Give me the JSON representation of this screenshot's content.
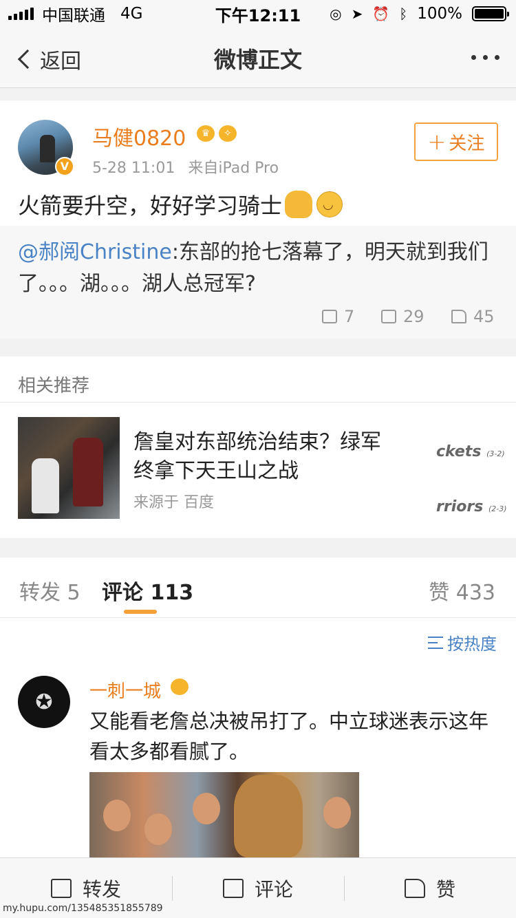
{
  "status_bar": {
    "carrier": "中国联通",
    "network": "4G",
    "time": "下午12:11",
    "battery": "100%",
    "battery_level": 1.0
  },
  "nav": {
    "back_label": "返回",
    "title": "微博正文"
  },
  "post": {
    "author": "马健0820",
    "time": "5-28 11:01",
    "source": "来自iPad Pro",
    "follow_label": "关注",
    "text": "火箭要升空，好好学习骑士",
    "repost": {
      "user": "@郝阅Christine",
      "text": ":东部的抢七落幕了，明天就到我们了。。。湖。。。湖人总冠军?"
    },
    "reposts": "7",
    "comments": "29",
    "likes": "45"
  },
  "related": {
    "title": "相关推荐",
    "headline": "詹皇对东部统治结束？绿军终拿下天王山之战",
    "source": "来源于 百度",
    "side_text_1": "ckets",
    "side_text_1_small": "(3-2)",
    "side_text_2": "rriors",
    "side_text_2_small": "(2-3)"
  },
  "tabs": {
    "reposts": "转发 5",
    "comments": "评论 113",
    "likes": "赞 433"
  },
  "comments": {
    "sort_label": "按热度",
    "items": [
      {
        "author": "一刺一城",
        "text": "又能看老詹总决被吊打了。中立球迷表示这年看太多都看腻了。"
      }
    ]
  },
  "toolbar": {
    "repost": "转发",
    "comment": "评论",
    "like": "赞"
  },
  "watermark": "my.hupu.com/135485351855789",
  "colors": {
    "accent": "#ea7d1e",
    "link": "#4a83c5",
    "tab_underline": "#f5a13a"
  }
}
